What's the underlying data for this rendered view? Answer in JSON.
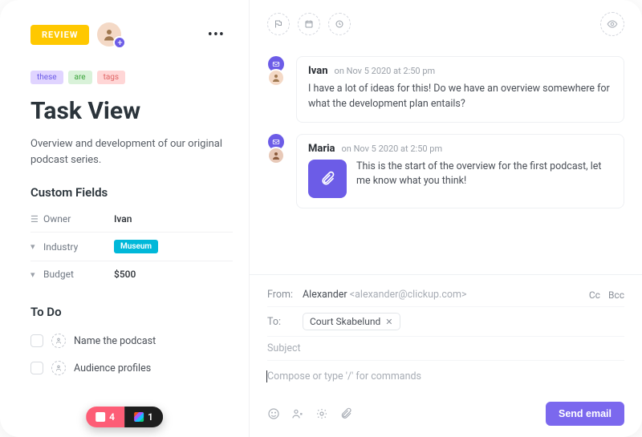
{
  "header": {
    "status": "REVIEW"
  },
  "tags": [
    "these",
    "are",
    "tags"
  ],
  "title": "Task View",
  "description": "Overview and development of our original podcast series.",
  "custom_fields": {
    "heading": "Custom Fields",
    "owner_label": "Owner",
    "owner_value": "Ivan",
    "industry_label": "Industry",
    "industry_value": "Museum",
    "budget_label": "Budget",
    "budget_value": "$500"
  },
  "todo": {
    "heading": "To Do",
    "items": [
      "Name the podcast",
      "Audience profiles"
    ]
  },
  "footer_pills": {
    "count_a": "4",
    "count_b": "1"
  },
  "comments": [
    {
      "author": "Ivan",
      "ts": "on Nov 5 2020 at 2:50 pm",
      "text": "I have a lot of ideas for this! Do we have an overview somewhere for what the development plan entails?"
    },
    {
      "author": "Maria",
      "ts": "on Nov 5 2020 at 2:50 pm",
      "text": "This is the start of the overview for the first podcast, let me know what you think!"
    }
  ],
  "composer": {
    "from_label": "From:",
    "from_name": "Alexander",
    "from_email": "<alexander@clickup.com>",
    "cc": "Cc",
    "bcc": "Bcc",
    "to_label": "To:",
    "to_chip": "Court Skabelund",
    "subject_ph": "Subject",
    "body_ph": "Compose or type '/' for commands",
    "send": "Send email"
  }
}
